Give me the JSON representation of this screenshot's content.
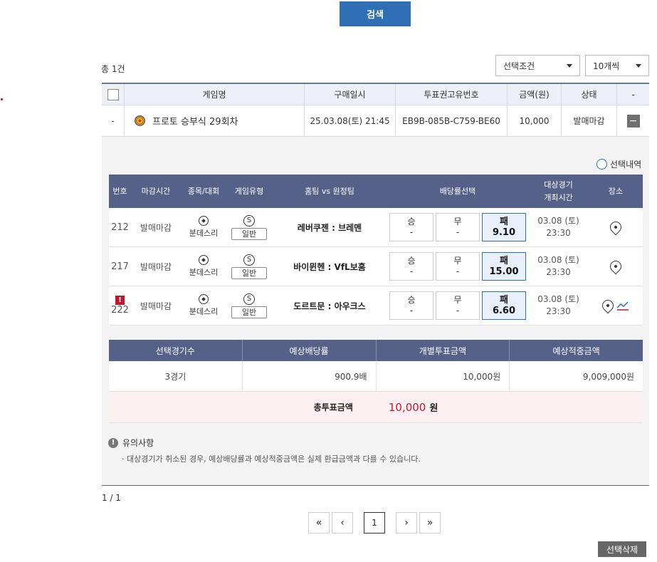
{
  "search_button": "검색",
  "total_count": "총 1건",
  "filters": {
    "condition": "선택조건",
    "page_size": "10개씩"
  },
  "main_table": {
    "headers": [
      "게임명",
      "구매일시",
      "투표권고유번호",
      "금액(원)",
      "상태",
      "-"
    ],
    "row": {
      "index": "-",
      "game_name": "프로토 승부식 29회차",
      "purchase_date": "25.03.08(토) 21:45",
      "ticket_id": "EB9B-085B-C759-BE60",
      "amount": "10,000",
      "status": "발매마감",
      "toggle": "−"
    }
  },
  "detail": {
    "select_detail_label": "선택내역",
    "headers": {
      "no": "번호",
      "close_time": "마감시간",
      "sport": "종목/대회",
      "game_type": "게임유형",
      "teams": "홈팀 vs 원정팀",
      "odds": "배당률선택",
      "match_time_1": "대상경기",
      "match_time_2": "개최시간",
      "venue": "장소"
    },
    "rows": [
      {
        "no": "212",
        "close": "발매마감",
        "sport": "분데스리",
        "type_icon": "S",
        "type_badge": "일반",
        "teams": "레버쿠젠 : 브레멘",
        "win_label": "승",
        "win_val": "-",
        "draw_label": "무",
        "draw_val": "-",
        "lose_label": "패",
        "lose_val": "9.10",
        "date": "03.08 (토)",
        "time": "23:30",
        "alert": ""
      },
      {
        "no": "217",
        "close": "발매마감",
        "sport": "분데스리",
        "type_icon": "S",
        "type_badge": "일반",
        "teams": "바이뮌헨 : VfL보훔",
        "win_label": "승",
        "win_val": "-",
        "draw_label": "무",
        "draw_val": "-",
        "lose_label": "패",
        "lose_val": "15.00",
        "date": "03.08 (토)",
        "time": "23:30",
        "alert": ""
      },
      {
        "no": "222",
        "close": "발매마감",
        "sport": "분데스리",
        "type_icon": "S",
        "type_badge": "일반",
        "teams": "도르트문 : 아우크스",
        "win_label": "승",
        "win_val": "-",
        "draw_label": "무",
        "draw_val": "-",
        "lose_label": "패",
        "lose_val": "6.60",
        "date": "03.08 (토)",
        "time": "23:30",
        "alert": "!"
      }
    ]
  },
  "summary": {
    "headers": [
      "선택경기수",
      "예상배당률",
      "개별투표금액",
      "예상적중금액"
    ],
    "values": [
      "3경기",
      "900.9배",
      "10,000원",
      "9,009,000원"
    ],
    "total_label": "총투표금액",
    "total_value": "10,000",
    "total_unit": "원"
  },
  "notice": {
    "title": "유의사항",
    "text": "· 대상경기가 취소된 경우, 예상배당률과 예상적중금액은 실제 환급금액과 다를 수 있습니다."
  },
  "pagination": {
    "info": "1 / 1",
    "first": "«",
    "prev": "‹",
    "current": "1",
    "next": "›",
    "last": "»"
  },
  "delete_button": "선택삭제",
  "colors": {
    "primary": "#2f6fb6",
    "header_bg": "#56618a",
    "highlight": "#c0172a"
  }
}
